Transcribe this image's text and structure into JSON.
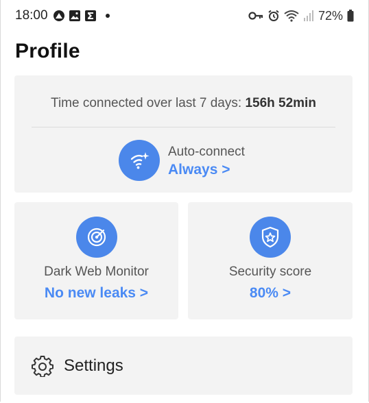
{
  "status_bar": {
    "time": "18:00",
    "battery": "72%",
    "left_icons": [
      "app-icon",
      "gallery-icon",
      "sigma-icon",
      "dot-icon"
    ],
    "right_icons": [
      "key-icon",
      "alarm-icon",
      "wifi-icon",
      "signal-icon",
      "battery-icon"
    ]
  },
  "page": {
    "title": "Profile"
  },
  "connection": {
    "time_label": "Time connected over last 7 days:",
    "time_value": "156h 52min"
  },
  "auto_connect": {
    "label": "Auto-connect",
    "value": "Always >",
    "icon": "wifi-sparkle-icon"
  },
  "dark_web_monitor": {
    "label": "Dark Web Monitor",
    "value": "No new leaks >",
    "icon": "radar-icon"
  },
  "security_score": {
    "label": "Security score",
    "value": "80% >",
    "icon": "shield-star-icon"
  },
  "settings": {
    "label": "Settings",
    "icon": "gear-icon"
  },
  "colors": {
    "accent": "#4a8af4",
    "card_bg": "#f3f3f3",
    "icon_circle": "#4b87ea"
  }
}
